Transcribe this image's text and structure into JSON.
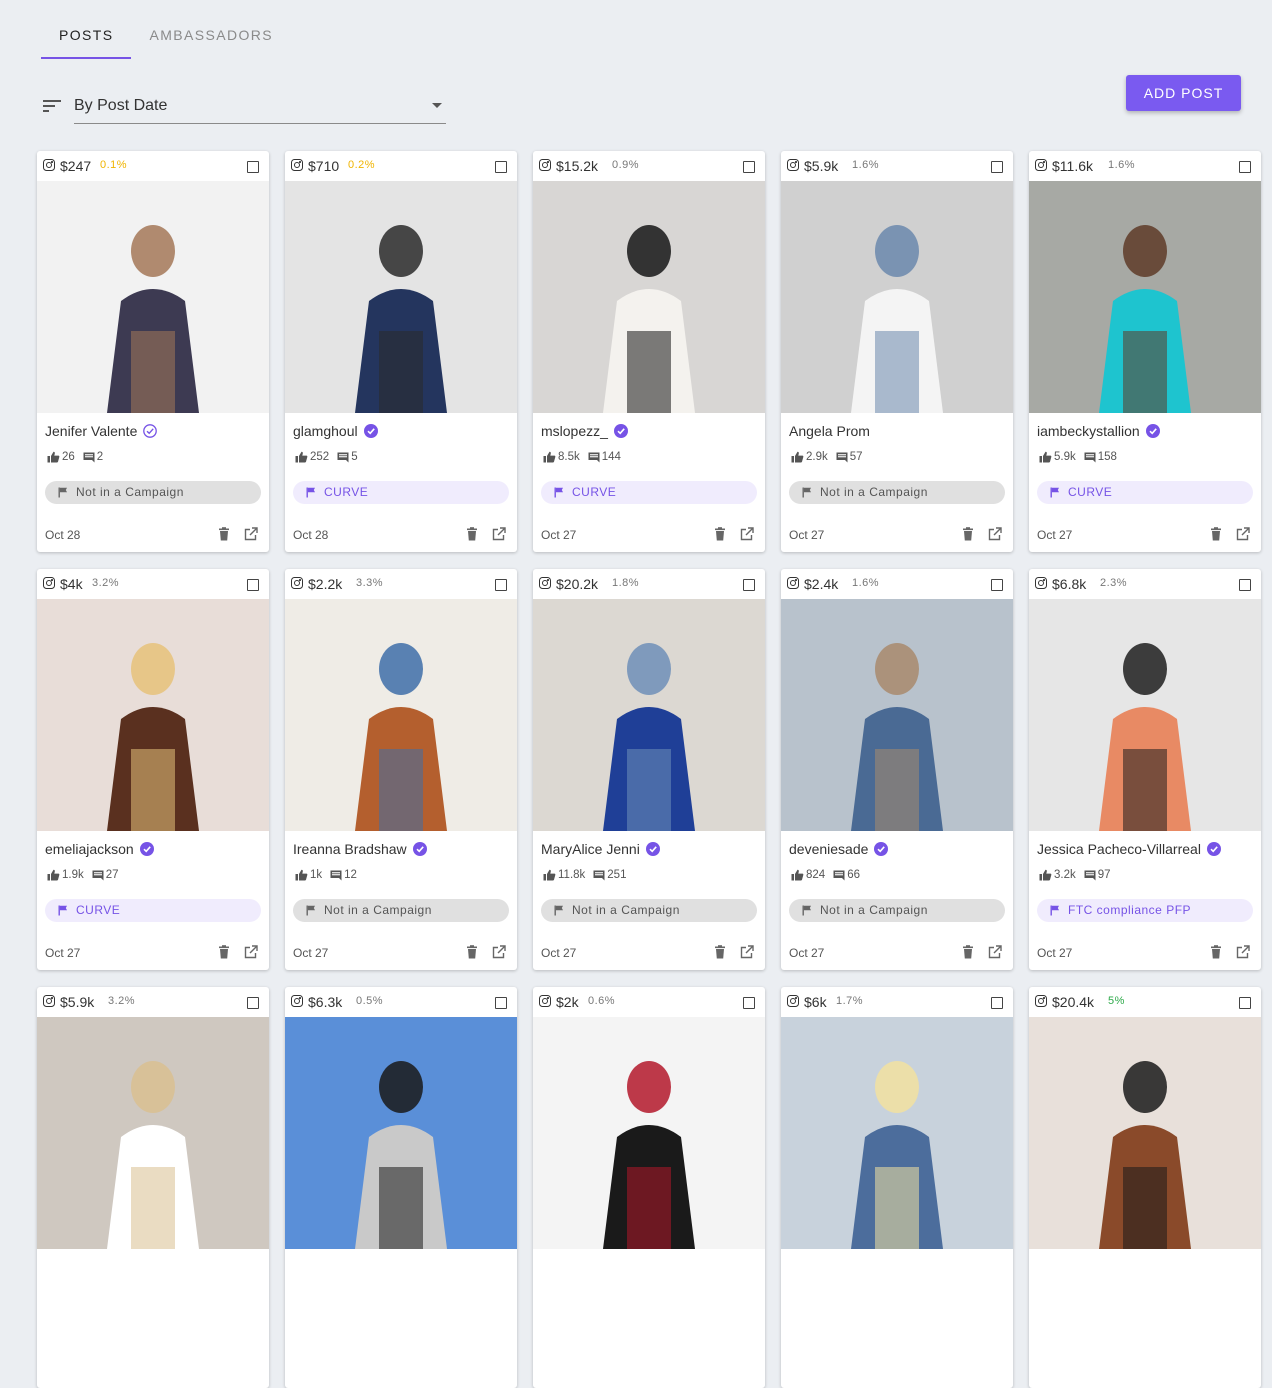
{
  "tabs": [
    {
      "label": "POSTS",
      "active": true
    },
    {
      "label": "AMBASSADORS",
      "active": false
    }
  ],
  "sort": {
    "selected": "By Post Date"
  },
  "add_post_label": "ADD POST",
  "colors": {
    "accent": "#7653e6",
    "rate_gold": "#f0b400",
    "rate_green": "#2eaa4a",
    "rate_default": "#777777"
  },
  "cards": [
    {
      "price": "$247",
      "rate": "0.1%",
      "rate_color": "gold",
      "name": "Jenifer Valente",
      "verified": "outline",
      "likes": "26",
      "comments": "2",
      "campaign": "Not in a Campaign",
      "campaign_style": "gray",
      "date": "Oct 28",
      "photo": [
        "#f2f2f2",
        "#3d3a52",
        "#a47858"
      ]
    },
    {
      "price": "$710",
      "rate": "0.2%",
      "rate_color": "gold",
      "name": "glamghoul",
      "verified": "filled",
      "likes": "252",
      "comments": "5",
      "campaign": "CURVE",
      "campaign_style": "purple",
      "date": "Oct 28",
      "photo": [
        "#e4e4e4",
        "#24355e",
        "#2a2a2a"
      ]
    },
    {
      "price": "$15.2k",
      "rate": "0.9%",
      "rate_color": "default",
      "name": "mslopezz_",
      "verified": "filled",
      "likes": "8.5k",
      "comments": "144",
      "campaign": "CURVE",
      "campaign_style": "purple",
      "date": "Oct 27",
      "photo": [
        "#d8d6d4",
        "#f4f2ee",
        "#161616"
      ]
    },
    {
      "price": "$5.9k",
      "rate": "1.6%",
      "rate_color": "default",
      "name": "Angela Prom",
      "verified": "none",
      "likes": "2.9k",
      "comments": "57",
      "campaign": "Not in a Campaign",
      "campaign_style": "gray",
      "date": "Oct 27",
      "photo": [
        "#d0d0d0",
        "#f4f4f4",
        "#6b88ad"
      ]
    },
    {
      "price": "$11.6k",
      "rate": "1.6%",
      "rate_color": "default",
      "name": "iambeckystallion",
      "verified": "filled",
      "likes": "5.9k",
      "comments": "158",
      "campaign": "CURVE",
      "campaign_style": "purple",
      "date": "Oct 27",
      "photo": [
        "#a7a9a4",
        "#1ec4cf",
        "#5e3b28"
      ]
    },
    {
      "price": "$4k",
      "rate": "3.2%",
      "rate_color": "default",
      "name": "emeliajackson",
      "verified": "filled",
      "likes": "1.9k",
      "comments": "27",
      "campaign": "CURVE",
      "campaign_style": "purple",
      "date": "Oct 27",
      "photo": [
        "#e8ddd8",
        "#5a301f",
        "#e6c27a"
      ]
    },
    {
      "price": "$2.2k",
      "rate": "3.3%",
      "rate_color": "default",
      "name": "Ireanna Bradshaw",
      "verified": "filled",
      "likes": "1k",
      "comments": "12",
      "campaign": "Not in a Campaign",
      "campaign_style": "gray",
      "date": "Oct 27",
      "photo": [
        "#efece6",
        "#b45f2e",
        "#3e6ea8"
      ]
    },
    {
      "price": "$20.2k",
      "rate": "1.8%",
      "rate_color": "default",
      "name": "MaryAlice Jenni",
      "verified": "filled",
      "likes": "11.8k",
      "comments": "251",
      "campaign": "Not in a Campaign",
      "campaign_style": "gray",
      "date": "Oct 27",
      "photo": [
        "#dcd8d2",
        "#1f3f97",
        "#6e8fb8"
      ]
    },
    {
      "price": "$2.4k",
      "rate": "1.6%",
      "rate_color": "default",
      "name": "deveniesade",
      "verified": "filled",
      "likes": "824",
      "comments": "66",
      "campaign": "Not in a Campaign",
      "campaign_style": "gray",
      "date": "Oct 27",
      "photo": [
        "#b8c2cc",
        "#4a6a94",
        "#a88a6c"
      ]
    },
    {
      "price": "$6.8k",
      "rate": "2.3%",
      "rate_color": "default",
      "name": "Jessica Pacheco-Villarreal",
      "verified": "filled",
      "likes": "3.2k",
      "comments": "97",
      "campaign": "FTC compliance PFP",
      "campaign_style": "purple",
      "date": "Oct 27",
      "photo": [
        "#e6e6e6",
        "#e88a64",
        "#1d1d1d"
      ]
    },
    {
      "price": "$5.9k",
      "rate": "3.2%",
      "rate_color": "default",
      "name": "",
      "verified": "none",
      "likes": "",
      "comments": "",
      "campaign": "",
      "campaign_style": "gray",
      "date": "",
      "photo": [
        "#cfc8c0",
        "#ffffff",
        "#d9c090"
      ]
    },
    {
      "price": "$6.3k",
      "rate": "0.5%",
      "rate_color": "default",
      "name": "",
      "verified": "none",
      "likes": "",
      "comments": "",
      "campaign": "",
      "campaign_style": "gray",
      "date": "",
      "photo": [
        "#5a8fd8",
        "#c9c9c9",
        "#1a1a1a"
      ]
    },
    {
      "price": "$2k",
      "rate": "0.6%",
      "rate_color": "default",
      "name": "",
      "verified": "none",
      "likes": "",
      "comments": "",
      "campaign": "",
      "campaign_style": "gray",
      "date": "",
      "photo": [
        "#f4f4f4",
        "#1a1a1a",
        "#b3172a"
      ]
    },
    {
      "price": "$6k",
      "rate": "1.7%",
      "rate_color": "default",
      "name": "",
      "verified": "none",
      "likes": "",
      "comments": "",
      "campaign": "",
      "campaign_style": "gray",
      "date": "",
      "photo": [
        "#c8d2dc",
        "#4c6d9c",
        "#f2e2a0"
      ]
    },
    {
      "price": "$20.4k",
      "rate": "5%",
      "rate_color": "green",
      "name": "",
      "verified": "none",
      "likes": "",
      "comments": "",
      "campaign": "",
      "campaign_style": "gray",
      "date": "",
      "photo": [
        "#e8e0da",
        "#8a4a2a",
        "#1a1a1a"
      ]
    }
  ]
}
